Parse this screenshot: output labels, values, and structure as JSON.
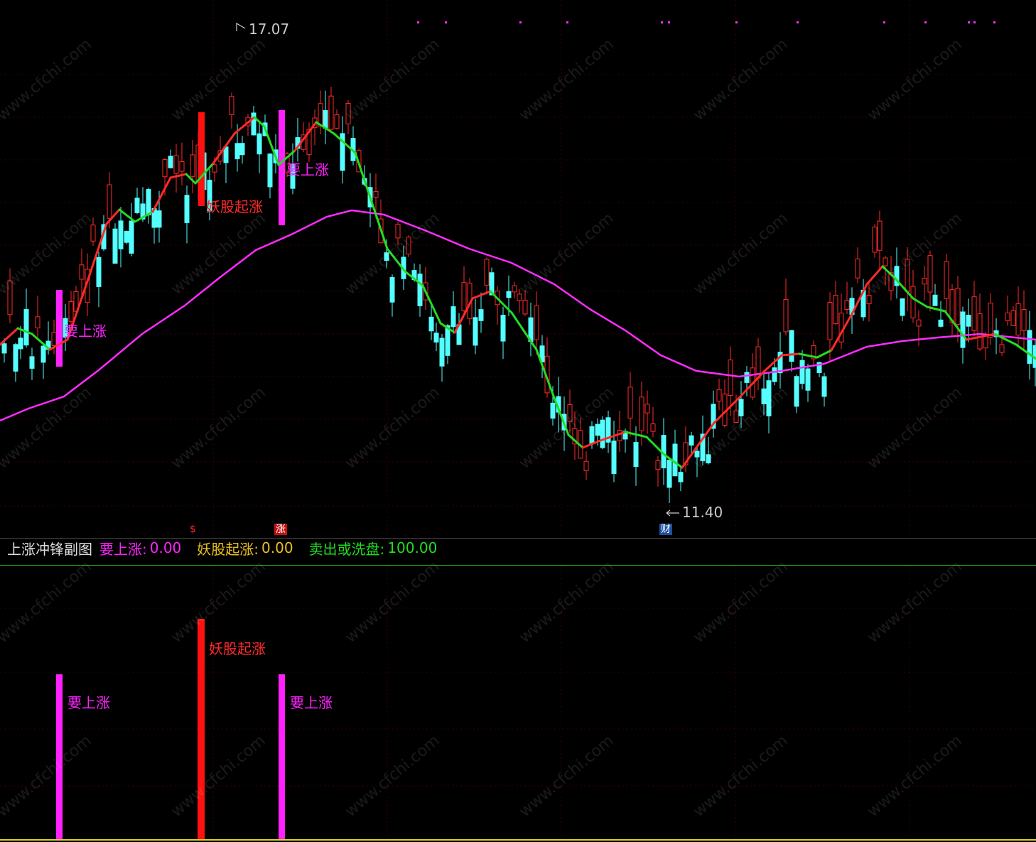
{
  "colors": {
    "bg": "#000000",
    "up": "#ff2a2a",
    "down": "#54ffff",
    "ma_long": "#ff2cff",
    "signal_yao": "#ff22ff",
    "signal_yaogu": "#ff1111",
    "sell": "#22dd22",
    "grid": "#3a0000"
  },
  "main": {
    "price_high_label": "17.07",
    "price_low_label": "11.40",
    "marker_up1": "$",
    "marker_up2": "涨",
    "marker_cai": "财",
    "signal_labels": {
      "yao1": "要上涨",
      "yaogu": "妖股起涨",
      "yao2": "要上涨"
    }
  },
  "indicator": {
    "name": "上涨冲锋副图",
    "items": [
      {
        "label": "要上涨:",
        "value": "0.00",
        "color": "#ff22ff"
      },
      {
        "label": "妖股起涨:",
        "value": "0.00",
        "color": "#e8c020"
      },
      {
        "label": "卖出或洗盘:",
        "value": "100.00",
        "color": "#22dd22"
      }
    ]
  },
  "sub": {
    "labels": {
      "yao1": "要上涨",
      "yaogu": "妖股起涨",
      "yao2": "要上涨"
    }
  },
  "watermark": "www.cfchi.com"
}
